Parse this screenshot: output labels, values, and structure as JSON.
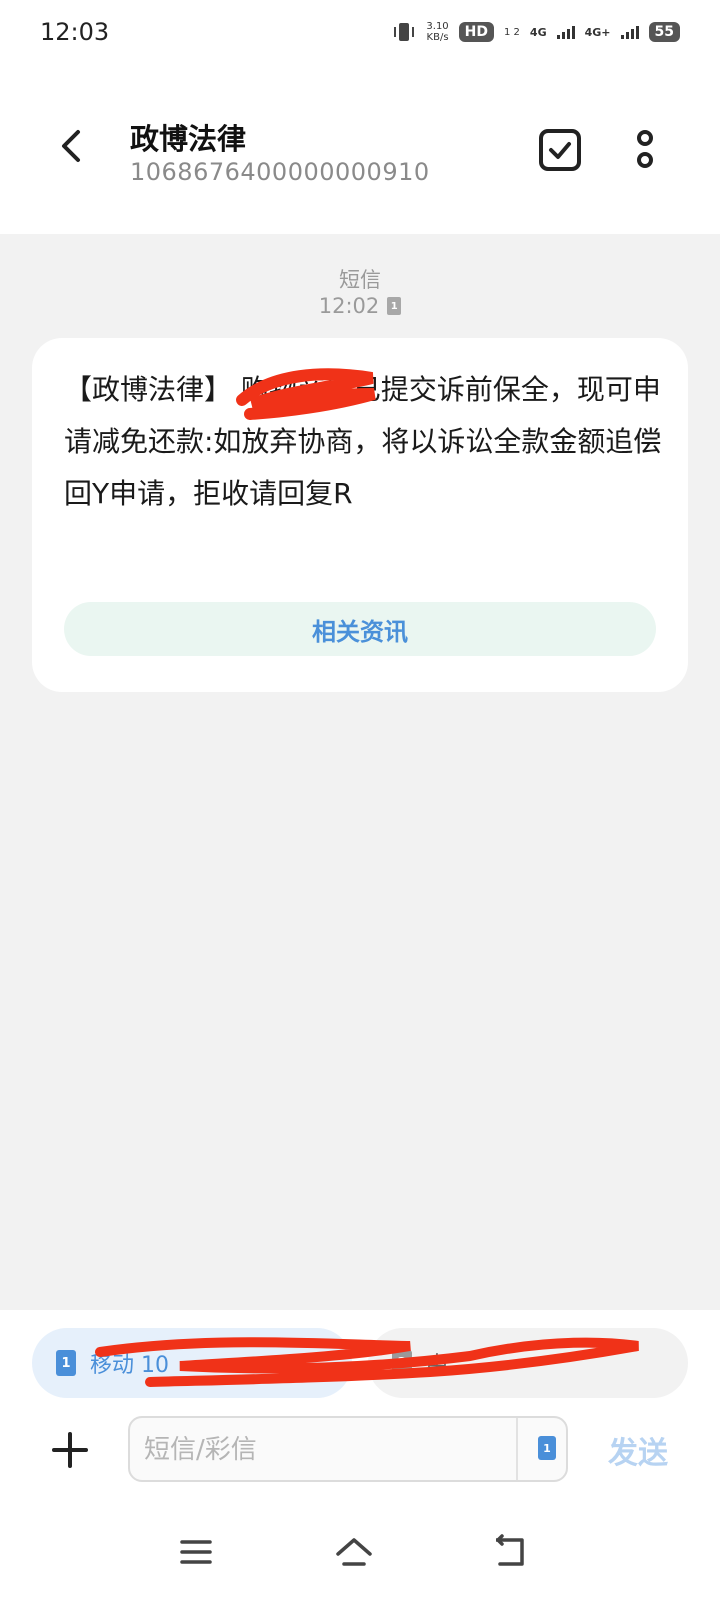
{
  "status_bar": {
    "time": "12:03",
    "net_speed_value": "3.10",
    "net_speed_unit": "KB/s",
    "hd_label": "HD",
    "sim_slots_label": "1 2",
    "network_1": "4G",
    "network_2": "4G+",
    "battery": "55"
  },
  "header": {
    "title": "政博法律",
    "subtitle": "1068676400000000910"
  },
  "conversation": {
    "message_type": "短信",
    "timestamp": "12:02",
    "sim_badge": "1",
    "message_text": "【政博法律】     购物商城已提交诉前保全，现可申请减免还款:如放弃协商，将以诉讼全款金额追偿回Y申请，拒收请回复R",
    "related_button": "相关资讯"
  },
  "sim_bar": {
    "sim1_number": "1",
    "sim1_label": "移动 10",
    "sim2_number": "2",
    "sim2_label": "中"
  },
  "compose": {
    "placeholder": "短信/彩信",
    "sim_selected": "1",
    "send_label": "发送"
  },
  "colors": {
    "accent": "#4a8fd9",
    "send_disabled": "#b7d3f2",
    "related_bg": "#eaf6f1",
    "redaction": "#f03218"
  }
}
